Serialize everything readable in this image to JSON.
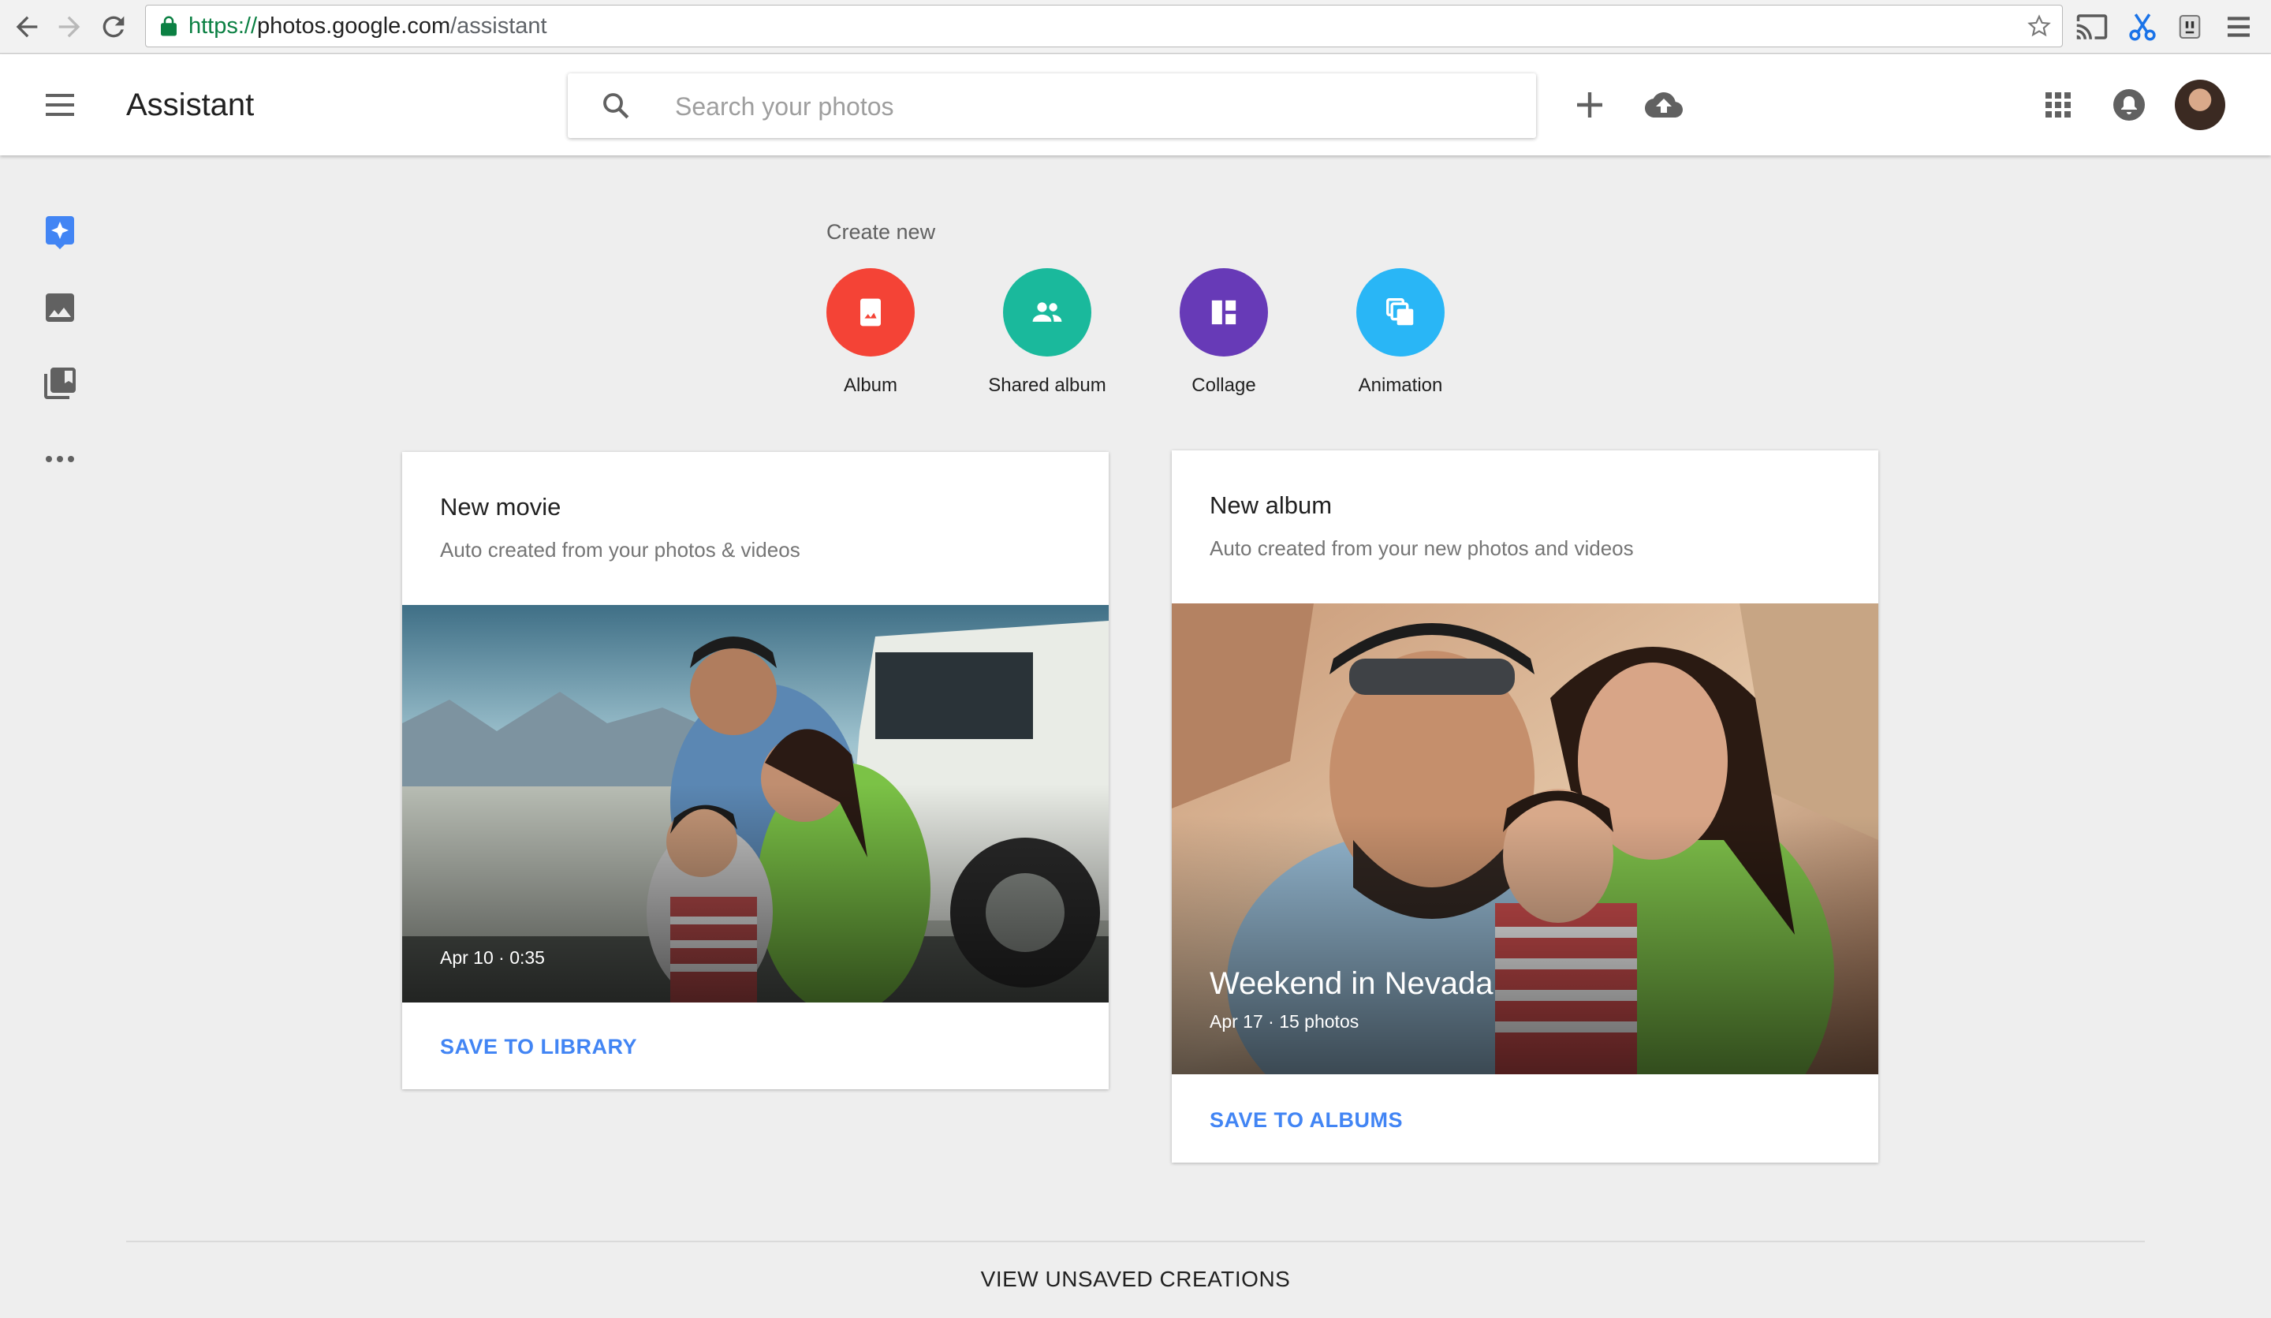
{
  "browser": {
    "url_scheme": "https://",
    "url_host": "photos.google.com",
    "url_path": "/assistant"
  },
  "header": {
    "title": "Assistant",
    "search_placeholder": "Search your photos",
    "icons": [
      "menu-icon",
      "search-icon",
      "plus-icon",
      "upload-cloud-icon",
      "apps-grid-icon",
      "notifications-icon"
    ]
  },
  "rail": {
    "items": [
      "assistant-icon",
      "photos-icon",
      "albums-icon",
      "more-icon"
    ],
    "accent": "#4285f4"
  },
  "create_new": {
    "title": "Create new",
    "items": [
      {
        "label": "Album",
        "color": "#f44336",
        "icon": "album-icon"
      },
      {
        "label": "Shared album",
        "color": "#1ab99c",
        "icon": "shared-album-icon"
      },
      {
        "label": "Collage",
        "color": "#673ab7",
        "icon": "collage-icon"
      },
      {
        "label": "Animation",
        "color": "#29b6f6",
        "icon": "animation-icon"
      }
    ]
  },
  "cards": [
    {
      "title": "New movie",
      "subtitle": "Auto created from your photos & videos",
      "meta": "Apr 10  ·  0:35",
      "action": "SAVE TO LIBRARY"
    },
    {
      "title": "New album",
      "subtitle": "Auto created from your new photos and videos",
      "caption": "Weekend in Nevada",
      "meta": "Apr 17  ·  15 photos",
      "action": "SAVE TO ALBUMS"
    }
  ],
  "footer": {
    "view_unsaved": "VIEW UNSAVED CREATIONS"
  }
}
